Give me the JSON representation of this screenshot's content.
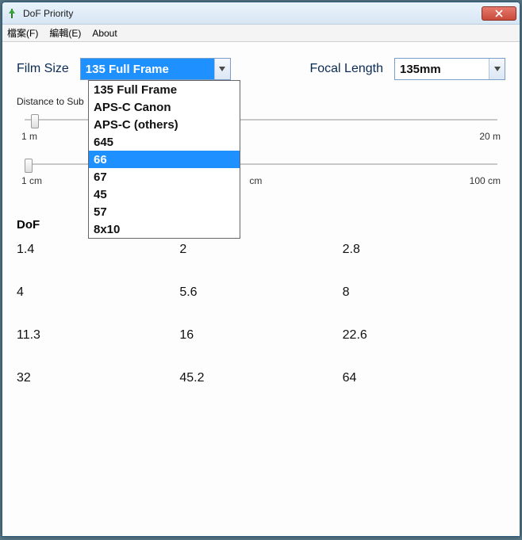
{
  "window": {
    "title": "DoF Priority"
  },
  "menu": {
    "file": "檔案(F)",
    "edit": "編輯(E)",
    "about": "About"
  },
  "labels": {
    "film_size": "Film Size",
    "focal_length": "Focal Length",
    "distance": "Distance to Sub",
    "dof": "DoF"
  },
  "film_size": {
    "selected": "135 Full Frame",
    "options": [
      "135 Full Frame",
      "APS-C Canon",
      "APS-C (others)",
      "645",
      "66",
      "67",
      "45",
      "57",
      "8x10"
    ],
    "highlighted": "66"
  },
  "focal_length": {
    "selected": "135mm"
  },
  "slider1": {
    "ticks": [
      "1 m",
      "20 m"
    ]
  },
  "slider2": {
    "ticks": [
      "1 cm",
      "cm",
      "100 cm"
    ]
  },
  "dof_values": [
    "1.4",
    "2",
    "2.8",
    "4",
    "5.6",
    "8",
    "11.3",
    "16",
    "22.6",
    "32",
    "45.2",
    "64"
  ]
}
